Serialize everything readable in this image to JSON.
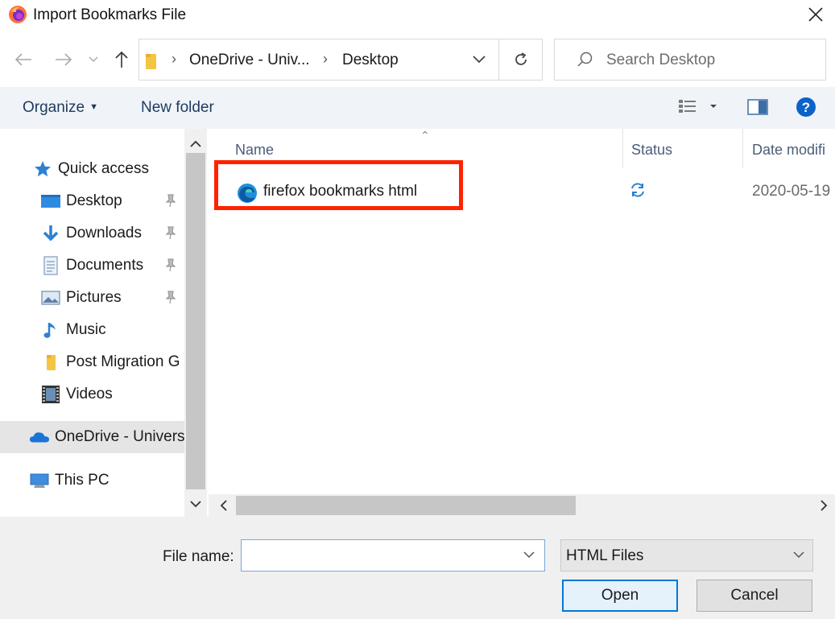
{
  "window": {
    "title": "Import Bookmarks File"
  },
  "address_bar": {
    "crumbs": [
      "OneDrive - Univ...",
      "Desktop"
    ]
  },
  "search": {
    "placeholder": "Search Desktop"
  },
  "toolbar": {
    "organize_label": "Organize",
    "new_folder_label": "New folder"
  },
  "sidebar": {
    "items": [
      {
        "label": "Quick access",
        "icon": "star-icon"
      },
      {
        "label": "Desktop",
        "icon": "desktop-folder-icon",
        "pinned": true
      },
      {
        "label": "Downloads",
        "icon": "download-arrow-icon",
        "pinned": true
      },
      {
        "label": "Documents",
        "icon": "documents-icon",
        "pinned": true
      },
      {
        "label": "Pictures",
        "icon": "pictures-icon",
        "pinned": true
      },
      {
        "label": "Music",
        "icon": "music-note-icon"
      },
      {
        "label": "Post Migration G",
        "icon": "folder-icon"
      },
      {
        "label": "Videos",
        "icon": "film-icon"
      },
      {
        "label": "OneDrive - Univers",
        "icon": "onedrive-cloud-icon",
        "selected": true
      },
      {
        "label": "This PC",
        "icon": "computer-icon"
      }
    ]
  },
  "file_list": {
    "columns": [
      "Name",
      "Status",
      "Date modifi"
    ],
    "rows": [
      {
        "name": "firefox bookmarks html",
        "status": "sync-pending-icon",
        "date": "2020-05-19",
        "icon": "edge-browser-icon",
        "highlighted": true
      }
    ]
  },
  "footer": {
    "file_name_label": "File name:",
    "file_name_value": "",
    "file_type": "HTML Files",
    "open_label": "Open",
    "cancel_label": "Cancel"
  },
  "colors": {
    "highlight_border": "#ff2200",
    "accent": "#0078d7",
    "toolbar_bg": "#f0f4f9"
  }
}
